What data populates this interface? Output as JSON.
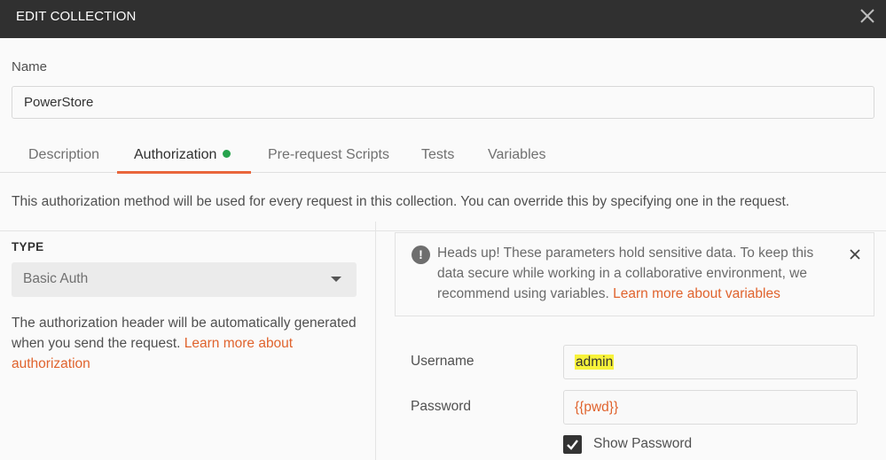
{
  "window": {
    "title": "EDIT COLLECTION"
  },
  "name_field": {
    "label": "Name",
    "value": "PowerStore"
  },
  "tabs": [
    {
      "label": "Description",
      "active": false
    },
    {
      "label": "Authorization",
      "active": true,
      "indicator": "green-dot"
    },
    {
      "label": "Pre-request Scripts",
      "active": false
    },
    {
      "label": "Tests",
      "active": false
    },
    {
      "label": "Variables",
      "active": false
    }
  ],
  "auth": {
    "info": "This authorization method will be used for every request in this collection. You can override this by specifying one in the request.",
    "type_label": "TYPE",
    "type_value": "Basic Auth",
    "description": "The authorization header will be automatically generated when you send the request.",
    "description_link": "Learn more about authorization"
  },
  "alert": {
    "message": "Heads up! These parameters hold sensitive data. To keep this data secure while working in a collaborative environment, we recommend using variables.",
    "link": "Learn more about variables"
  },
  "credentials": {
    "username_label": "Username",
    "username_value": "admin",
    "password_label": "Password",
    "password_value": "{{pwd}}",
    "show_password_label": "Show Password",
    "show_password_checked": true
  },
  "colors": {
    "accent": "#e9663b",
    "link": "#e0632d",
    "active_dot": "#26a34c",
    "titlebar": "#303030",
    "highlight": "#f7f23a"
  }
}
